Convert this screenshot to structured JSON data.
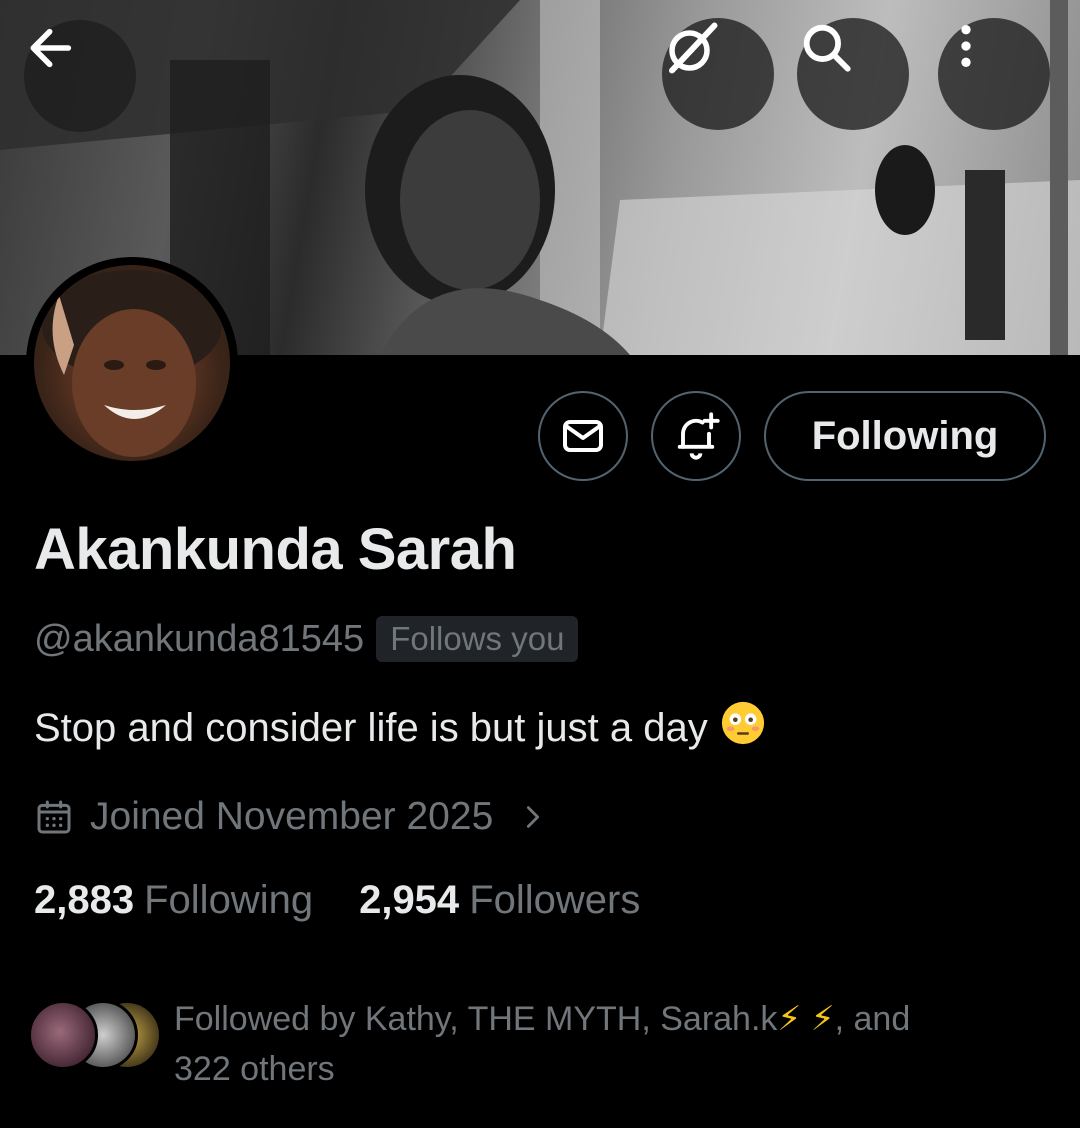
{
  "header": {
    "back_icon": "arrow-left-icon",
    "grok_icon": "grok-icon",
    "search_icon": "search-icon",
    "more_icon": "more-vertical-icon"
  },
  "profile": {
    "name": "Akankunda Sarah",
    "handle": "@akankunda81545",
    "follows_you": "Follows you",
    "bio": "Stop and consider life is but just a day",
    "bio_emoji": "flushed-face-emoji",
    "joined": "Joined November 2025",
    "following_count": "2,883",
    "following_label": "Following",
    "followers_count": "2,954",
    "followers_label": "Followers"
  },
  "actions": {
    "message_icon": "mail-icon",
    "notify_icon": "bell-plus-icon",
    "following_button": "Following"
  },
  "followed_by": {
    "prefix": "Followed by Kathy, THE MYTH, Sarah.k",
    "bolt": "⚡",
    "suffix": ", and",
    "others": "322 others"
  },
  "colors": {
    "background": "#000000",
    "text_primary": "#e7e9ea",
    "text_secondary": "#71767b",
    "border": "#536471",
    "badge_bg": "#202327",
    "bolt": "#f5c518"
  }
}
